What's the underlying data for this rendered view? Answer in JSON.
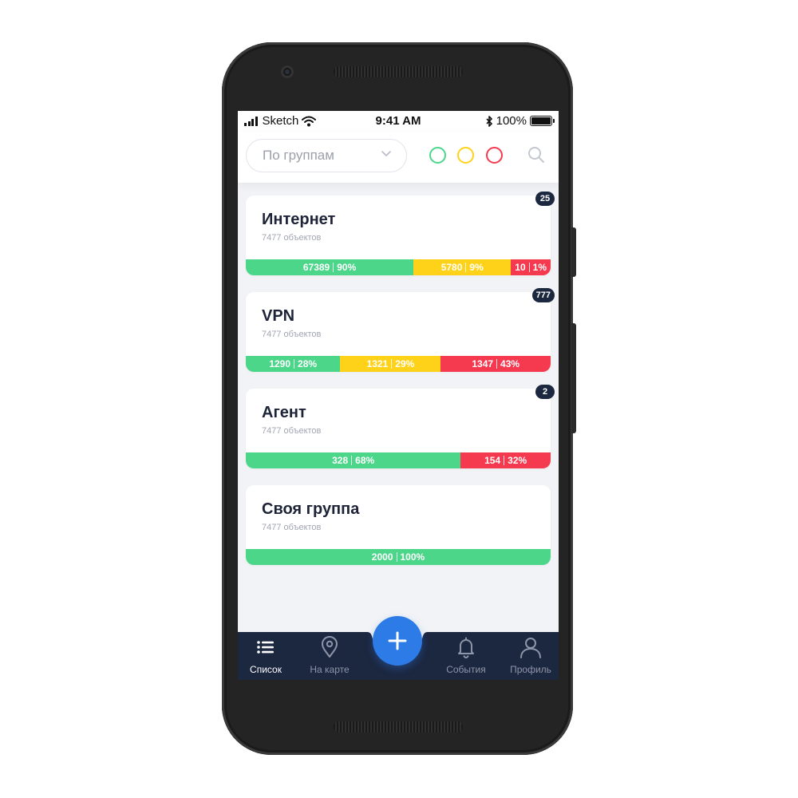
{
  "status": {
    "carrier": "Sketch",
    "time": "9:41 AM",
    "battery": "100%",
    "battery_level": 1.0
  },
  "toolbar": {
    "dropdown_value": "По группам",
    "filters": [
      {
        "name": "green",
        "color": "#4cd68a"
      },
      {
        "name": "yellow",
        "color": "#ffd21a"
      },
      {
        "name": "red",
        "color": "#f5394f"
      }
    ],
    "search_icon": "search-icon"
  },
  "colors": {
    "ok": "#4cd68a",
    "warn": "#ffd21a",
    "error": "#f5394f",
    "nav_bg": "#1c2740",
    "accent": "#2d7be6"
  },
  "groups": [
    {
      "title": "Интернет",
      "subtitle": "7477 объектов",
      "badge": "25",
      "segments": [
        {
          "status": "ok",
          "count": "67389",
          "percent": "90%",
          "share": 0.55
        },
        {
          "status": "warn",
          "count": "5780",
          "percent": "9%",
          "share": 0.32
        },
        {
          "status": "error",
          "count": "10",
          "percent": "1%",
          "share": 0.13
        }
      ]
    },
    {
      "title": "VPN",
      "subtitle": "7477 объектов",
      "badge": "777",
      "segments": [
        {
          "status": "ok",
          "count": "1290",
          "percent": "28%",
          "share": 0.31
        },
        {
          "status": "warn",
          "count": "1321",
          "percent": "29%",
          "share": 0.33
        },
        {
          "status": "error",
          "count": "1347",
          "percent": "43%",
          "share": 0.36
        }
      ]
    },
    {
      "title": "Агент",
      "subtitle": "7477 объектов",
      "badge": "2",
      "segments": [
        {
          "status": "ok",
          "count": "328",
          "percent": "68%",
          "share": 0.705
        },
        {
          "status": "error",
          "count": "154",
          "percent": "32%",
          "share": 0.295
        }
      ]
    },
    {
      "title": "Своя группа",
      "subtitle": "7477 объектов",
      "badge": "",
      "segments": [
        {
          "status": "ok",
          "count": "2000",
          "percent": "100%",
          "share": 1.0
        }
      ]
    }
  ],
  "nav": {
    "items": [
      {
        "label": "Список",
        "icon": "list-icon",
        "active": true
      },
      {
        "label": "На карте",
        "icon": "map-pin-icon",
        "active": false
      },
      {
        "label": "События",
        "icon": "bell-icon",
        "active": false
      },
      {
        "label": "Профиль",
        "icon": "user-icon",
        "active": false
      }
    ],
    "fab_icon": "plus-icon"
  }
}
